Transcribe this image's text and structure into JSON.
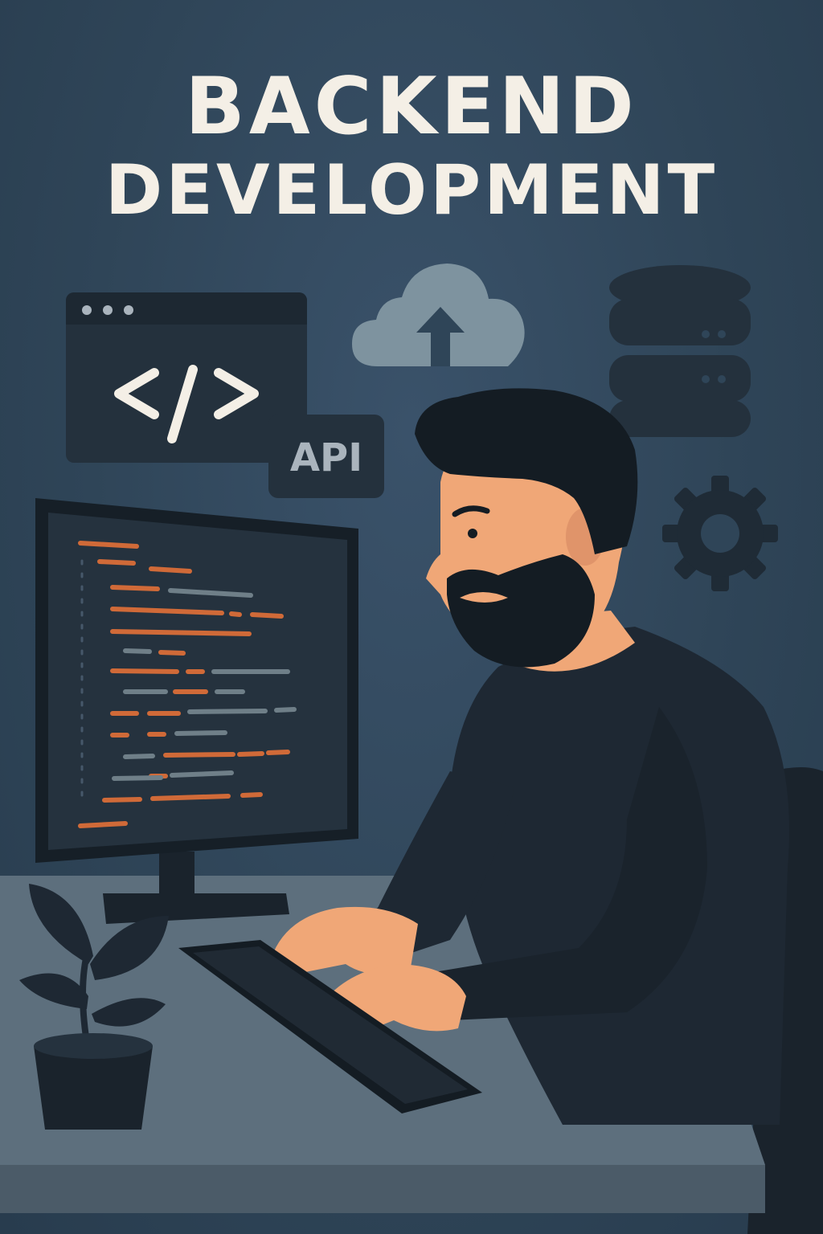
{
  "title": {
    "line1": "BACKEND",
    "line2": "DEVELOPMENT"
  },
  "api_badge": {
    "label": "API"
  },
  "icons": {
    "code_window": "code-brackets-icon",
    "cloud_upload": "cloud-upload-icon",
    "database": "database-server-icon",
    "gear": "gear-icon"
  },
  "colors": {
    "background": "#2f4558",
    "title_text": "#f4efe6",
    "code_orange": "#d06a38",
    "code_gray": "#6f7f88",
    "skin": "#f0a777",
    "shirt": "#1e2833",
    "desk": "#5d6f7d"
  }
}
